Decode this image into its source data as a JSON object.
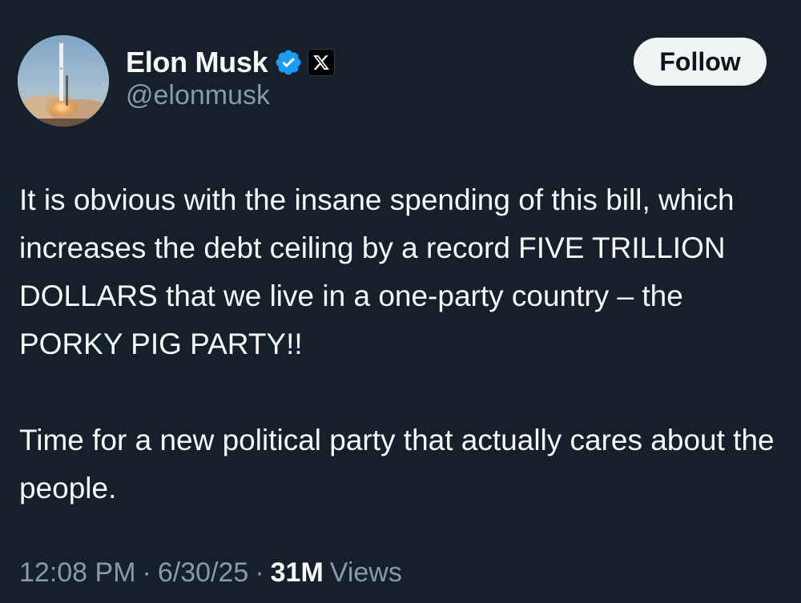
{
  "author": {
    "display_name": "Elon Musk",
    "handle": "@elonmusk",
    "avatar_icon": "rocket-launch-avatar",
    "verified_icon": "verified-badge-icon",
    "affiliation_icon": "x-logo-icon"
  },
  "actions": {
    "follow_label": "Follow"
  },
  "tweet": {
    "paragraphs": [
      "It is obvious with the insane spending of this bill, which increases the debt ceiling by a record FIVE TRILLION DOLLARS that we live in a one-party country – the PORKY PIG PARTY!!",
      "Time for a new political party that actually cares about the people."
    ]
  },
  "meta": {
    "time": "12:08 PM",
    "date": "6/30/25",
    "separator": "·",
    "views_count": "31M",
    "views_label": "Views"
  },
  "colors": {
    "background": "#15202b",
    "text": "#f7f9f9",
    "secondary_text": "#8b98a5",
    "verified_blue": "#1d9bf0",
    "follow_bg": "#eff3f4"
  }
}
